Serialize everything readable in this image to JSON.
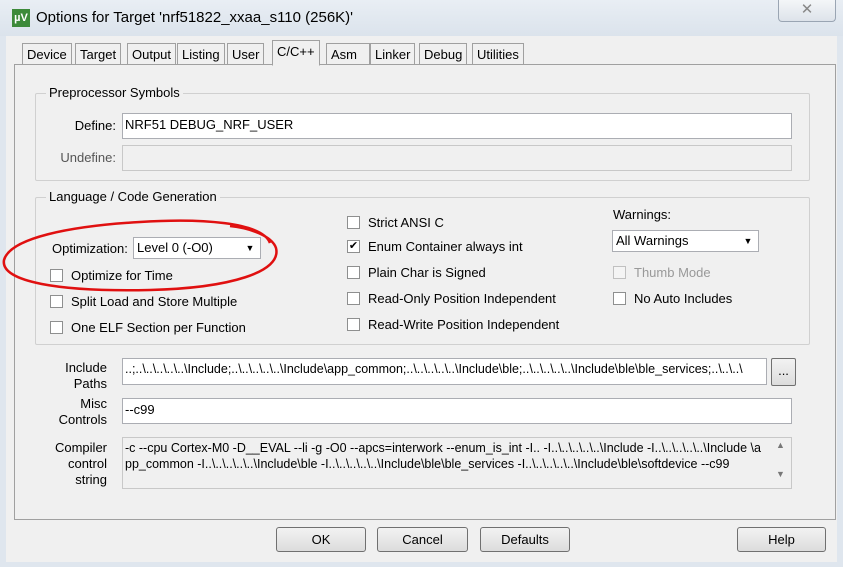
{
  "window": {
    "title": "Options for Target 'nrf51822_xxaa_s110 (256K)'",
    "app_icon": "µV",
    "close_glyph": "✕"
  },
  "tabs": [
    {
      "label": "Device"
    },
    {
      "label": "Target"
    },
    {
      "label": "Output"
    },
    {
      "label": "Listing"
    },
    {
      "label": "User"
    },
    {
      "label": "C/C++",
      "selected": true
    },
    {
      "label": "Asm"
    },
    {
      "label": "Linker"
    },
    {
      "label": "Debug"
    },
    {
      "label": "Utilities"
    }
  ],
  "preprocessor": {
    "title": "Preprocessor Symbols",
    "define_label": "Define:",
    "define_value": "NRF51 DEBUG_NRF_USER",
    "undefine_label": "Undefine:",
    "undefine_value": ""
  },
  "language": {
    "title": "Language / Code Generation",
    "optimization_label": "Optimization:",
    "optimization_value": "Level 0 (-O0)",
    "left_checks": [
      {
        "label": "Optimize for Time",
        "checked": false
      },
      {
        "label": "Split Load and Store Multiple",
        "checked": false
      },
      {
        "label": "One ELF Section per Function",
        "checked": false
      }
    ],
    "mid_checks": [
      {
        "label": "Strict ANSI C",
        "checked": false
      },
      {
        "label": "Enum Container always int",
        "checked": true
      },
      {
        "label": "Plain Char is Signed",
        "checked": false
      },
      {
        "label": "Read-Only Position Independent",
        "checked": false
      },
      {
        "label": "Read-Write Position Independent",
        "checked": false
      }
    ],
    "warnings_label": "Warnings:",
    "warnings_value": "All Warnings",
    "thumb_mode": {
      "label": "Thumb Mode",
      "checked": false,
      "disabled": true
    },
    "no_auto_includes": {
      "label": "No Auto Includes",
      "checked": false
    }
  },
  "include": {
    "label1": "Include",
    "label2": "Paths",
    "value": "..;..\\..\\..\\..\\..\\Include;..\\..\\..\\..\\..\\Include\\app_common;..\\..\\..\\..\\..\\Include\\ble;..\\..\\..\\..\\..\\Include\\ble\\ble_services;..\\..\\..\\",
    "browse": "..."
  },
  "misc": {
    "label1": "Misc",
    "label2": "Controls",
    "value": "--c99"
  },
  "compiler": {
    "label1": "Compiler",
    "label2": "control",
    "label3": "string",
    "value": "-c --cpu Cortex-M0 -D__EVAL --li -g -O0 --apcs=interwork --enum_is_int -I.. -I..\\..\\..\\..\\..\\Include -I..\\..\\..\\..\\..\\Include \\app_common -I..\\..\\..\\..\\..\\Include\\ble -I..\\..\\..\\..\\..\\Include\\ble\\ble_services -I..\\..\\..\\..\\..\\Include\\ble\\softdevice --c99"
  },
  "buttons": {
    "ok": "OK",
    "cancel": "Cancel",
    "defaults": "Defaults",
    "help": "Help"
  },
  "annotation_color": "#e01010"
}
